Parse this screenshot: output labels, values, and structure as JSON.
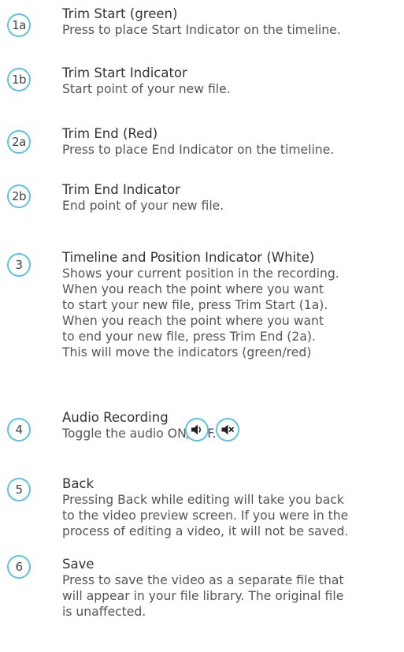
{
  "entries": [
    {
      "badge": "1a",
      "title": "Trim Start (green)",
      "lines": [
        "Press to place Start Indicator on the timeline."
      ]
    },
    {
      "badge": "1b",
      "title": "Trim Start Indicator",
      "lines": [
        "Start point of your new file."
      ]
    },
    {
      "badge": "2a",
      "title": "Trim End (Red)",
      "lines": [
        "Press to place End Indicator on the timeline."
      ]
    },
    {
      "badge": "2b",
      "title": "Trim End Indicator",
      "lines": [
        "End point of your new file."
      ]
    },
    {
      "badge": "3",
      "title": "Timeline and Position Indicator (White)",
      "lines": [
        "Shows your current position in the recording.",
        "When you reach the point where you want",
        "to start your new file, press Trim Start (1a).",
        "When you reach the point where you want",
        "to end your new file, press Trim End (2a).",
        "This will move the indicators (green/red)"
      ]
    },
    {
      "badge": "4",
      "title": "Audio Recording",
      "lines": [
        "Toggle the audio ON/OFF."
      ]
    },
    {
      "badge": "5",
      "title": "Back",
      "lines": [
        "Pressing Back while editing will take you back",
        "to the video preview screen. If you were in the",
        "process of editing a video, it will not be saved."
      ]
    },
    {
      "badge": "6",
      "title": "Save",
      "lines": [
        "Press to save the video as a separate file that",
        "will appear in your file library. The original file",
        "is unaffected."
      ]
    }
  ],
  "audio_icons": [
    "speaker-on-icon",
    "speaker-muted-icon"
  ],
  "colors": {
    "accent": "#5bc2df",
    "title": "#333333",
    "text": "#555555"
  }
}
